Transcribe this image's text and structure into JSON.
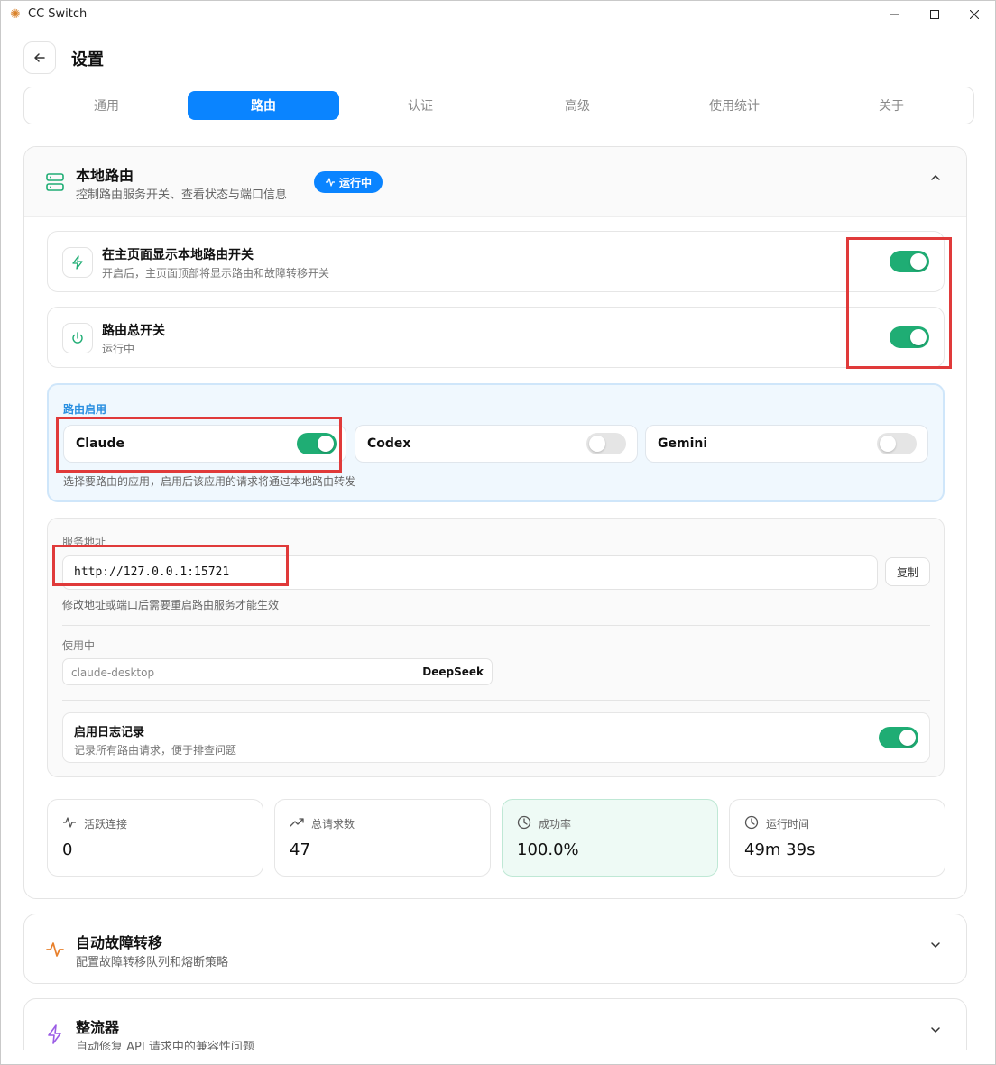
{
  "window": {
    "title": "CC Switch"
  },
  "header": {
    "title": "设置"
  },
  "tabs": [
    {
      "label": "通用",
      "active": false
    },
    {
      "label": "路由",
      "active": true
    },
    {
      "label": "认证",
      "active": false
    },
    {
      "label": "高级",
      "active": false
    },
    {
      "label": "使用统计",
      "active": false
    },
    {
      "label": "关于",
      "active": false
    }
  ],
  "local_route": {
    "title": "本地路由",
    "subtitle": "控制路由服务开关、查看状态与端口信息",
    "badge": "运行中",
    "show_switch": {
      "title": "在主页面显示本地路由开关",
      "subtitle": "开启后，主页面顶部将显示路由和故障转移开关",
      "enabled": true
    },
    "master_switch": {
      "title": "路由总开关",
      "subtitle": "运行中",
      "enabled": true
    },
    "route_enable": {
      "label": "路由启用",
      "apps": [
        {
          "name": "Claude",
          "enabled": true
        },
        {
          "name": "Codex",
          "enabled": false
        },
        {
          "name": "Gemini",
          "enabled": false
        }
      ],
      "note": "选择要路由的应用，启用后该应用的请求将通过本地路由转发"
    },
    "service": {
      "label": "服务地址",
      "address": "http://127.0.0.1:15721",
      "copy_label": "复制",
      "note": "修改地址或端口后需要重启路由服务才能生效",
      "in_use_label": "使用中",
      "in_use_client": "claude-desktop",
      "in_use_provider": "DeepSeek",
      "log": {
        "title": "启用日志记录",
        "subtitle": "记录所有路由请求，便于排查问题",
        "enabled": true
      }
    },
    "stats": [
      {
        "label": "活跃连接",
        "value": "0",
        "icon": "activity-icon"
      },
      {
        "label": "总请求数",
        "value": "47",
        "icon": "trending-up-icon"
      },
      {
        "label": "成功率",
        "value": "100.0%",
        "icon": "clock-icon"
      },
      {
        "label": "运行时间",
        "value": "49m 39s",
        "icon": "clock-icon"
      }
    ]
  },
  "failover": {
    "title": "自动故障转移",
    "subtitle": "配置故障转移队列和熔断策略"
  },
  "rectifier": {
    "title": "整流器",
    "subtitle": "自动修复 API 请求中的兼容性问题"
  },
  "colors": {
    "accent": "#0a84ff",
    "toggle_on": "#1fad74",
    "highlight": "#e03a3a"
  }
}
